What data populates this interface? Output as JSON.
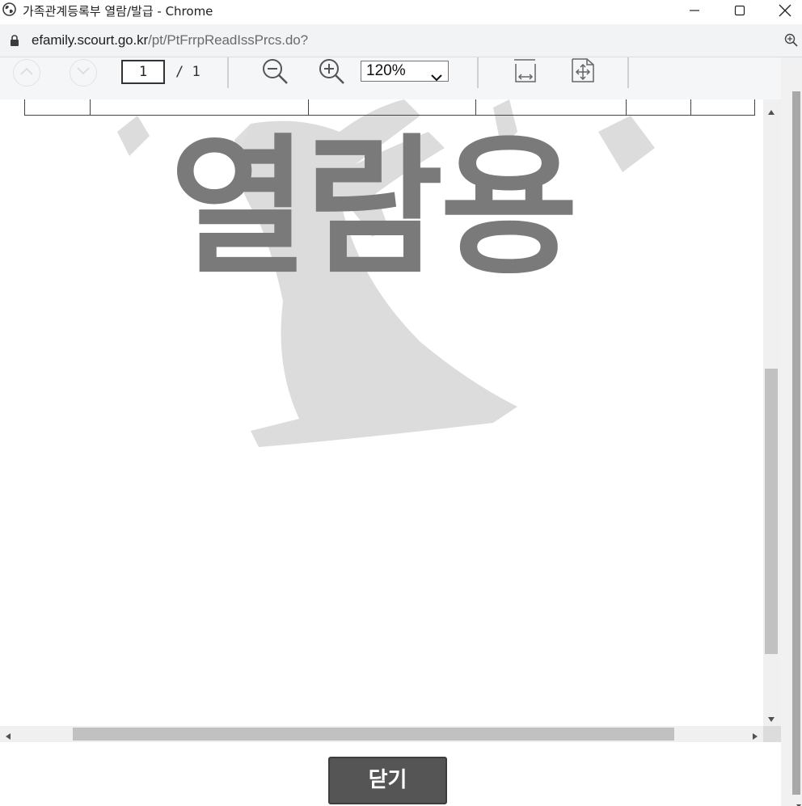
{
  "window": {
    "title": "가족관계등록부 열람/발급 - Chrome",
    "minimize_icon": "minimize-icon",
    "maximize_icon": "maximize-icon",
    "close_icon": "close-icon"
  },
  "address_bar": {
    "domain": "efamily.scourt.go.kr",
    "path": "/pt/PtFrrpReadIssPrcs.do?"
  },
  "pdf_toolbar": {
    "prev_page_icon": "chevron-up-icon",
    "next_page_icon": "chevron-down-icon",
    "current_page": "1",
    "page_total": "/ 1",
    "zoom_out_icon": "zoom-out-icon",
    "zoom_in_icon": "zoom-in-icon",
    "zoom_level": "120%",
    "fit_width_icon": "fit-width-icon",
    "fit_page_icon": "fit-page-icon"
  },
  "document": {
    "watermark": "열람용"
  },
  "footer": {
    "close_label": "닫기"
  },
  "colors": {
    "close_button_bg": "#555555",
    "watermark_text": "#7a7a7a",
    "watermark_figure": "#dcdcdc"
  }
}
